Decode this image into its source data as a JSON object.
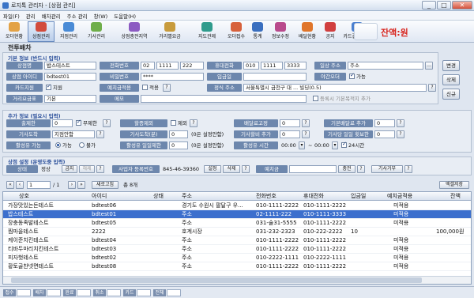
{
  "window": {
    "title": "로지톡 관리자 - [상점 관리]",
    "controls": [
      "_",
      "□",
      "✕"
    ]
  },
  "menu": [
    "파일(F)",
    "관리",
    "배차관리",
    "주소 관리",
    "창(W)",
    "도움말(H)"
  ],
  "toolbar": {
    "items": [
      "오더현황",
      "상점관리",
      "지점관리",
      "기사관리",
      "상점충전지역",
      "거리별요금",
      "지도관제",
      "오더접수",
      "통계",
      "정보수정",
      "배달현황",
      "공지",
      "카드결제 관리"
    ],
    "active": "상점관리",
    "balance": "잔액:원",
    "colors": {
      "active_border": "#6a8cc0",
      "balance": "#d8231c"
    }
  },
  "page": {
    "title": "전투배차"
  },
  "basic": {
    "legend": "기본 정보 (반드시 입력)",
    "shop_name_label": "상점명",
    "shop_name": "밥스테스트",
    "phone_label": "전화번호",
    "phone": [
      "02",
      "1111",
      "222"
    ],
    "mobile_label": "휴대전화",
    "mobile": [
      "010",
      "1111",
      "3333"
    ],
    "addr_label": "일상 주소",
    "addr": "주소",
    "id_label": "상점 아이디",
    "id": "bdtest01",
    "pw_label": "비밀번호",
    "pw": "****",
    "deposit_label": "입금일",
    "deposit": "",
    "night_label": "야간오더",
    "night_check": "가능",
    "card_label": "카드지원",
    "card_check": "지원",
    "prepay_label": "예치금적용",
    "prepay_check": "적용",
    "exact_addr_label": "정식 주소",
    "exact_addr": "서울특별시 금천구 대 ... 빌딩(0.5)",
    "reg_unreg": "등록시 기본목적지 추가",
    "fee_label": "거리요금표",
    "fee": "기본",
    "memo_label": "메모",
    "memo": ""
  },
  "side_buttons": [
    "변경",
    "삭제",
    "신규"
  ],
  "extra": {
    "legend": "추가 정보 (필요시 입력)",
    "limit_label": "출제한",
    "limit": "0",
    "limit_check": "무제한",
    "kill_label": "할증제외",
    "kill_check": "제외",
    "deliv_label": "배달료고정",
    "deliv": "0",
    "base_add_label": "기본배달료 추가",
    "base_add": "0",
    "driver_label": "기사도착",
    "driver": "지점안함",
    "driver_time_label": "기사도착(분)",
    "driver_time": "0",
    "driver_time_note": "(0은 설정안함)",
    "driver_fee_label": "기사할비 추가",
    "driver_fee": "0",
    "driver_daily_label": "기사당 일일 횟보한",
    "driver_daily": "0",
    "status_label": "활성유 가능",
    "status_options": [
      "가능",
      "불가"
    ],
    "daily_label": "활성유 일일제한",
    "daily": "0",
    "daily_note": "(0은 설정안함)",
    "time_label": "활성유 시간",
    "time_from": "00:00",
    "time_to": "00:00",
    "time_24": "24시간"
  },
  "store": {
    "legend": "상점 설정 (운영도중 입력)",
    "state_label": "상태",
    "state": "정상",
    "state_btns": [
      "금지",
      "해제"
    ],
    "biz_label": "사업자 등록번호",
    "biz": "845-46-39360",
    "biz_btns": [
      "설정",
      "삭제"
    ],
    "prepaid_label": "예치금",
    "prepaid": "",
    "charge_btn": "충전",
    "driver_reject_btn": "기사거부"
  },
  "pager": {
    "page": "1",
    "total": "/ 1",
    "refresh_btn": "새로고침",
    "count": "총 8개",
    "excel_btn": "엑셀저장"
  },
  "grid": {
    "headers": [
      "상호",
      "아이디",
      "상태",
      "주소",
      "전화번호",
      "휴대전화",
      "입금일",
      "예치금적용",
      "잔액"
    ],
    "rows": [
      [
        "가장맛있는돈테스트",
        "bdtest06",
        "",
        "경기도 수원시 팔달구 우...",
        "010-1111-2222",
        "010-1111-2222",
        "",
        "미적용",
        ""
      ],
      [
        "밥스테스트",
        "bdtest01",
        "",
        "주소",
        "02-1111-222",
        "010-1111-3333",
        "",
        "미적용",
        ""
      ],
      [
        "장충동족발테스트",
        "bdtest05",
        "",
        "주소",
        "031-술31-5555",
        "010-1111-2222",
        "",
        "미적용",
        ""
      ],
      [
        "찜마을테스트",
        "2222",
        "",
        "호계시장",
        "031-232-2323",
        "010-222-2222",
        "10",
        "",
        "100,000원"
      ],
      [
        "케이준치킨테스트",
        "bdtest04",
        "",
        "주소",
        "010-1111-2222",
        "010-1111-2222",
        "",
        "미적용",
        ""
      ],
      [
        "티바두마리치킨테스트",
        "bdtest03",
        "",
        "주소",
        "010-1111-2222",
        "010-1111-2222",
        "",
        "미적용",
        ""
      ],
      [
        "피자헛테스트",
        "bdtest02",
        "",
        "주소",
        "010-2222-1111",
        "010-2222-1111",
        "",
        "미적용",
        ""
      ],
      [
        "황토골찬넷면테스트",
        "bdtest08",
        "",
        "주소",
        "010-1111-2222",
        "010-1111-2222",
        "",
        "미적용",
        ""
      ]
    ],
    "selected_index": 1,
    "colors": {
      "selected": "#3c6fcd"
    }
  },
  "status": [
    "접수",
    "배차",
    "완료",
    "취소",
    "카드",
    "전체"
  ]
}
